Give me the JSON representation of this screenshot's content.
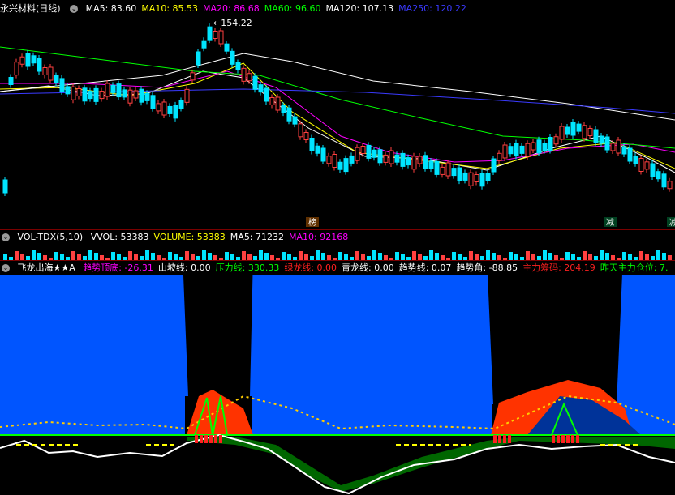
{
  "price_panel": {
    "stock_name": "永兴材料",
    "period": "(日线)",
    "ma": [
      {
        "label": "MA5:",
        "value": "83.60",
        "color": "#ffffff"
      },
      {
        "label": "MA10:",
        "value": "85.53",
        "color": "#ffff00"
      },
      {
        "label": "MA20:",
        "value": "86.68",
        "color": "#ff00ff"
      },
      {
        "label": "MA60:",
        "value": "96.60",
        "color": "#00ff00"
      },
      {
        "label": "MA120:",
        "value": "107.13",
        "color": "#ffffff"
      },
      {
        "label": "MA250:",
        "value": "120.22",
        "color": "#3a3aff"
      }
    ],
    "high_label": "154.22",
    "markers": [
      "榜",
      "减",
      "减"
    ]
  },
  "vol_panel": {
    "title": "VOL-TDX(5,10)",
    "items": [
      {
        "label": "VVOL:",
        "value": "53383",
        "color": "#ffffff"
      },
      {
        "label": "VOLUME:",
        "value": "53383",
        "color": "#ffff00"
      },
      {
        "label": "MA5:",
        "value": "71232",
        "color": "#ffffff"
      },
      {
        "label": "MA10:",
        "value": "92168",
        "color": "#ff00ff"
      }
    ]
  },
  "indicator_panel": {
    "title": "飞龙出海★★A",
    "items": [
      {
        "label": "趋势顶底:",
        "value": "-26.31",
        "color": "#ff00ff"
      },
      {
        "label": "山坡线:",
        "value": "0.00",
        "color": "#ffffff"
      },
      {
        "label": "压力线:",
        "value": "330.33",
        "color": "#00ff00"
      },
      {
        "label": "绿龙线:",
        "value": "0.00",
        "color": "#ff2020"
      },
      {
        "label": "青龙线:",
        "value": "0.00",
        "color": "#ffffff"
      },
      {
        "label": "趋势线:",
        "value": "0.07",
        "color": "#ffffff"
      },
      {
        "label": "趋势角:",
        "value": "-88.85",
        "color": "#ffffff"
      },
      {
        "label": "主力筹码:",
        "value": "204.19",
        "color": "#ff2020"
      },
      {
        "label": "昨天主力仓位:",
        "value": "7.",
        "color": "#00ff00"
      }
    ]
  }
}
